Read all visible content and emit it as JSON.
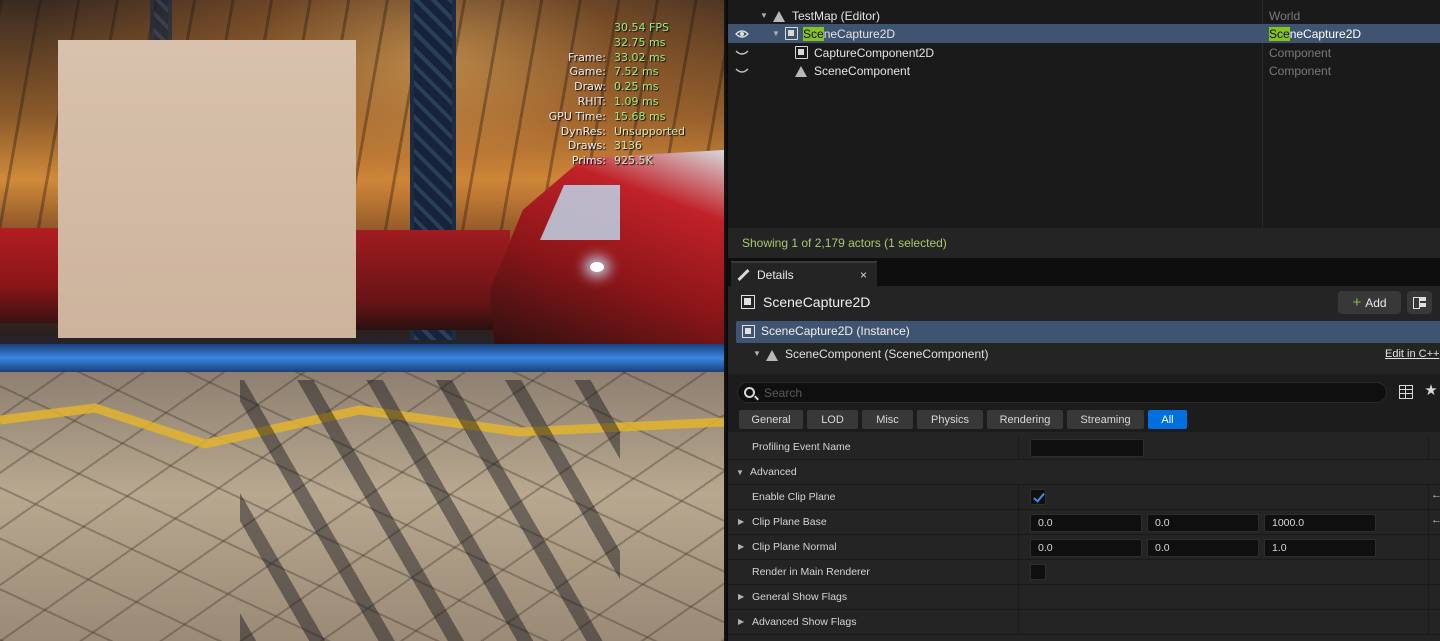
{
  "viewport": {
    "stats": [
      {
        "label": "",
        "value": "30.54 FPS"
      },
      {
        "label": "",
        "value": "32.75 ms"
      },
      {
        "label": "Frame:",
        "value": "33.02 ms"
      },
      {
        "label": "Game:",
        "value": "7.52 ms"
      },
      {
        "label": "Draw:",
        "value": "0.25 ms"
      },
      {
        "label": "RHIT:",
        "value": "1.09 ms"
      },
      {
        "label": "GPU Time:",
        "value": "15.68 ms"
      },
      {
        "label": "DynRes:",
        "value": "Unsupported"
      },
      {
        "label": "Draws:",
        "value": "3136"
      },
      {
        "label": "Prims:",
        "value": "925.5K"
      }
    ]
  },
  "outliner": {
    "rows": [
      {
        "label": "TestMap (Editor)",
        "type": "World"
      },
      {
        "label_highlight": "Sce",
        "label_rest": "neCapture2D",
        "type_highlight": "Sce",
        "type_rest": "neCapture2D"
      },
      {
        "label": "CaptureComponent2D",
        "type": "Component"
      },
      {
        "label": "SceneComponent",
        "type": "Component"
      }
    ],
    "status": "Showing 1 of 2,179 actors (1 selected)"
  },
  "details": {
    "tab_label": "Details",
    "tab_close": "×",
    "object_name": "SceneCapture2D",
    "add_label": "Add",
    "add_plus": "+",
    "instance_label": "SceneCapture2D (Instance)",
    "component_label": "SceneComponent (SceneComponent)",
    "edit_link": "Edit in C++",
    "search_placeholder": "Search",
    "favorite_glyph": "★",
    "filters": [
      "General",
      "LOD",
      "Misc",
      "Physics",
      "Rendering",
      "Streaming",
      "All"
    ],
    "properties": {
      "profiling_event_name": "Profiling Event Name",
      "advanced": "Advanced",
      "enable_clip_plane": "Enable Clip Plane",
      "clip_plane_base": "Clip Plane Base",
      "clip_plane_base_values": [
        "0.0",
        "0.0",
        "1000.0"
      ],
      "clip_plane_normal": "Clip Plane Normal",
      "clip_plane_normal_values": [
        "0.0",
        "0.0",
        "1.0"
      ],
      "render_in_main_renderer": "Render in Main Renderer",
      "general_show_flags": "General Show Flags",
      "advanced_show_flags": "Advanced Show Flags"
    },
    "reset_glyph": "←"
  }
}
